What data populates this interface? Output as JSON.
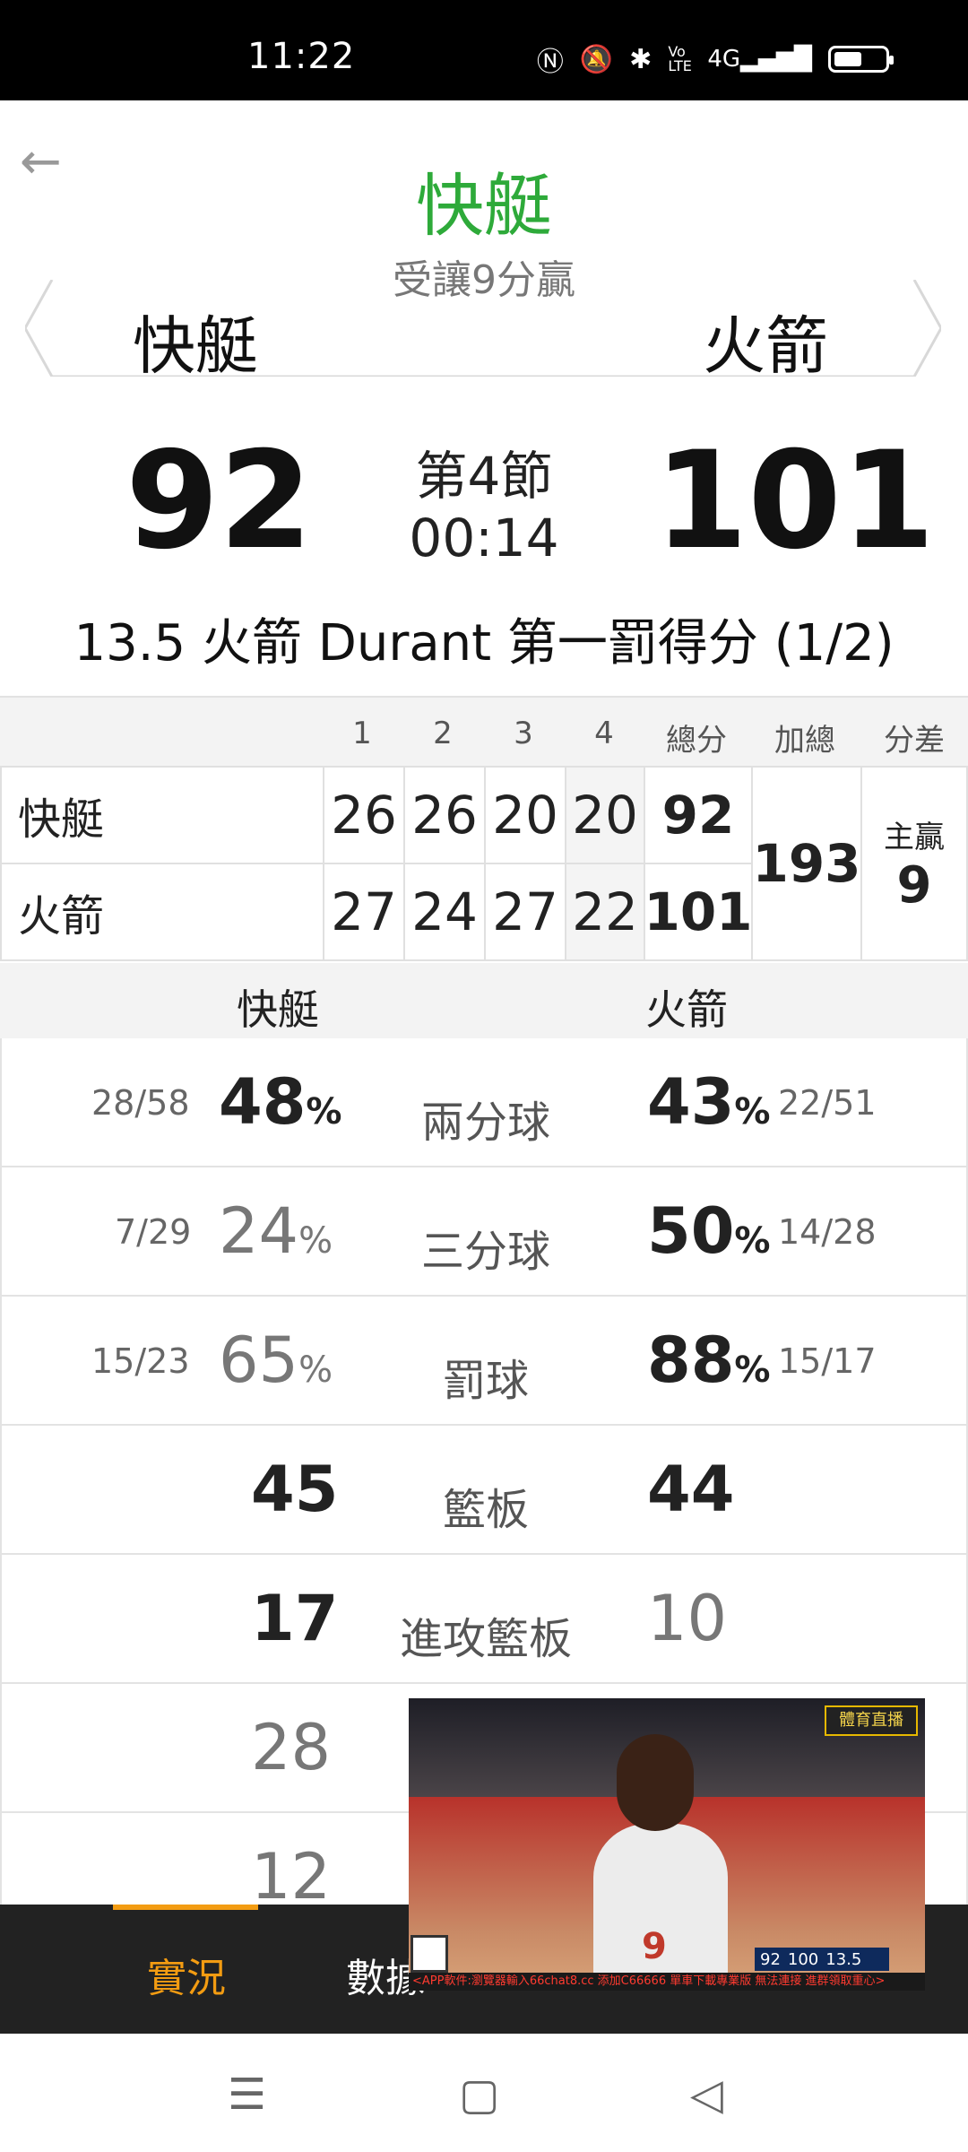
{
  "status_bar": {
    "time": "11:22",
    "icons": [
      "nfc-icon",
      "mute-icon",
      "bluetooth-icon",
      "volte-icon",
      "4g-signal-icon",
      "battery-icon"
    ],
    "network_label": "4G",
    "volte_label": "Vo LTE"
  },
  "header": {
    "favored_team": "快艇",
    "handicap_text": "受讓9分贏",
    "home_team": "快艇",
    "away_team": "火箭"
  },
  "score": {
    "home": "92",
    "away": "101",
    "period": "第4節",
    "clock": "00:14",
    "last_play": "13.5 火箭 Durant 第一罰得分 (1/2)"
  },
  "quarter_table": {
    "headers": [
      "1",
      "2",
      "3",
      "4",
      "總分",
      "加總",
      "分差"
    ],
    "rows": [
      {
        "team": "快艇",
        "q": [
          "26",
          "26",
          "20",
          "20"
        ],
        "total": "92"
      },
      {
        "team": "火箭",
        "q": [
          "27",
          "24",
          "27",
          "22"
        ],
        "total": "101"
      }
    ],
    "sum": "193",
    "diff_label": "主贏",
    "diff_value": "9"
  },
  "stats": {
    "home_label": "快艇",
    "away_label": "火箭",
    "rows": [
      {
        "name": "兩分球",
        "home_frac": "28/58",
        "home_pct": "48",
        "away_pct": "43",
        "away_frac": "22/51",
        "unit": "%"
      },
      {
        "name": "三分球",
        "home_frac": "7/29",
        "home_pct": "24",
        "away_pct": "50",
        "away_frac": "14/28",
        "unit": "%"
      },
      {
        "name": "罰球",
        "home_frac": "15/23",
        "home_pct": "65",
        "away_pct": "88",
        "away_frac": "15/17",
        "unit": "%"
      },
      {
        "name": "籃板",
        "home_val": "45",
        "away_val": "44"
      },
      {
        "name": "進攻籃板",
        "home_val": "17",
        "away_val": "10"
      },
      {
        "home_val": "28"
      },
      {
        "home_val": "12"
      }
    ]
  },
  "tabs": [
    {
      "label": "實況",
      "active": true
    },
    {
      "label": "數據",
      "active": false
    }
  ],
  "video": {
    "logo_text": "體育直播",
    "jersey_number": "9",
    "scorebug_home": "92",
    "scorebug_away": "100",
    "scorebug_clock": "13.5",
    "ticker": "<APP軟件:瀏覽器輸入66chat8.cc 添加C66666 單車下載專業版 無法連接 進群領取重心>"
  },
  "nav_bar": {
    "icons": [
      "menu-icon",
      "home-square-icon",
      "back-triangle-icon"
    ]
  },
  "colors": {
    "accent_green": "#2eaa3a",
    "accent_orange": "#f39c12",
    "tab_bar_bg": "#222222"
  }
}
